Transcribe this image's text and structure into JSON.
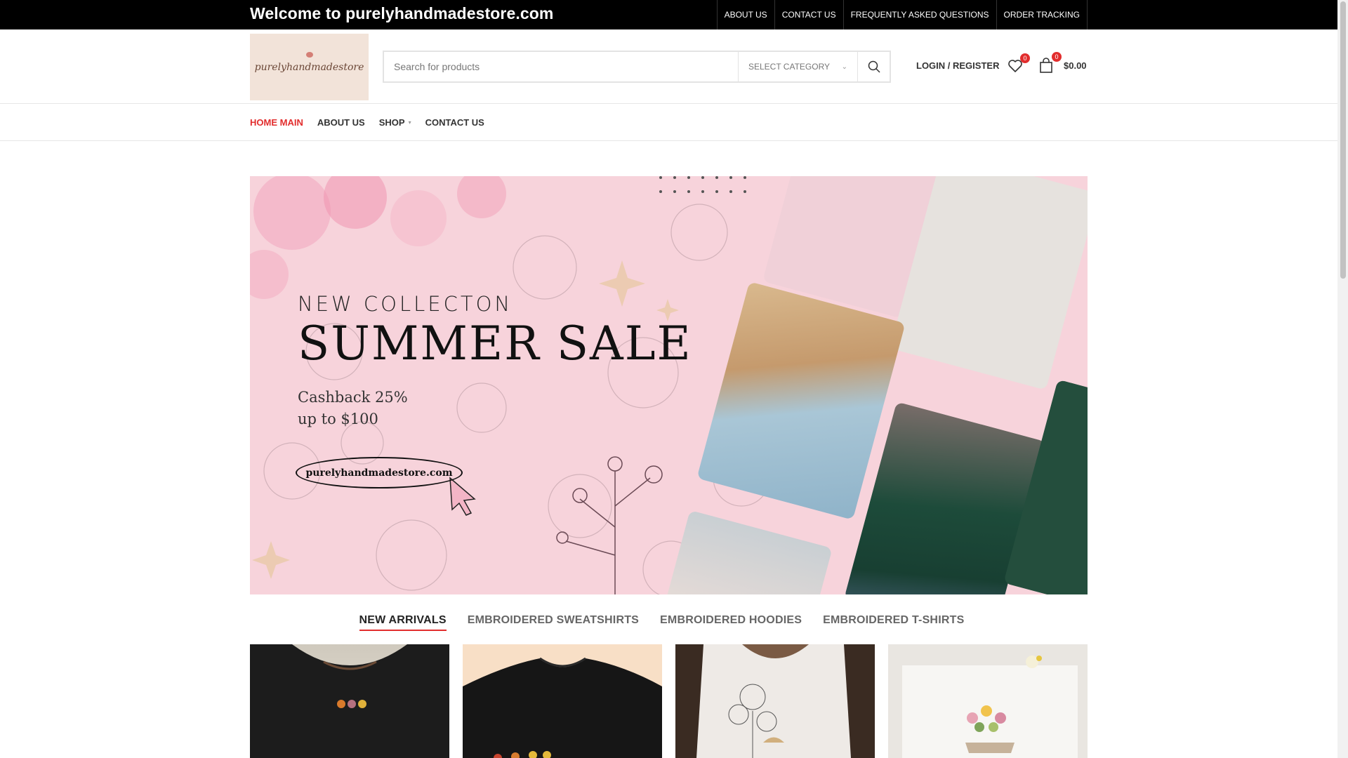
{
  "topbar": {
    "welcome": "Welcome to purelyhandmadestore.com",
    "links": [
      "ABOUT US",
      "CONTACT US",
      "FREQUENTLY ASKED QUESTIONS",
      "ORDER TRACKING"
    ]
  },
  "header": {
    "logo_text": "purelyhandmadestore",
    "search_placeholder": "Search for products",
    "category_label": "SELECT CATEGORY",
    "login_label": "LOGIN / REGISTER",
    "wishlist_count": "0",
    "cart_count": "0",
    "cart_total": "$0.00"
  },
  "nav": {
    "items": [
      "HOME MAIN",
      "ABOUT US",
      "SHOP",
      "CONTACT US"
    ],
    "active": "HOME MAIN"
  },
  "hero": {
    "line1": "NEW COLLECTON",
    "line2": "SUMMER SALE",
    "cash1": "Cashback 25%",
    "cash2": "up to $100",
    "url": "purelyhandmadestore.com"
  },
  "tabs": {
    "items": [
      "NEW ARRIVALS",
      "EMBROIDERED SWEATSHIRTS",
      "EMBROIDERED HOODIES",
      "EMBROIDERED T-SHIRTS"
    ],
    "active": "NEW ARRIVALS"
  },
  "colors": {
    "accent": "#e22d2d",
    "hero_bg": "#f7d3db",
    "topbar_bg": "#000000"
  }
}
